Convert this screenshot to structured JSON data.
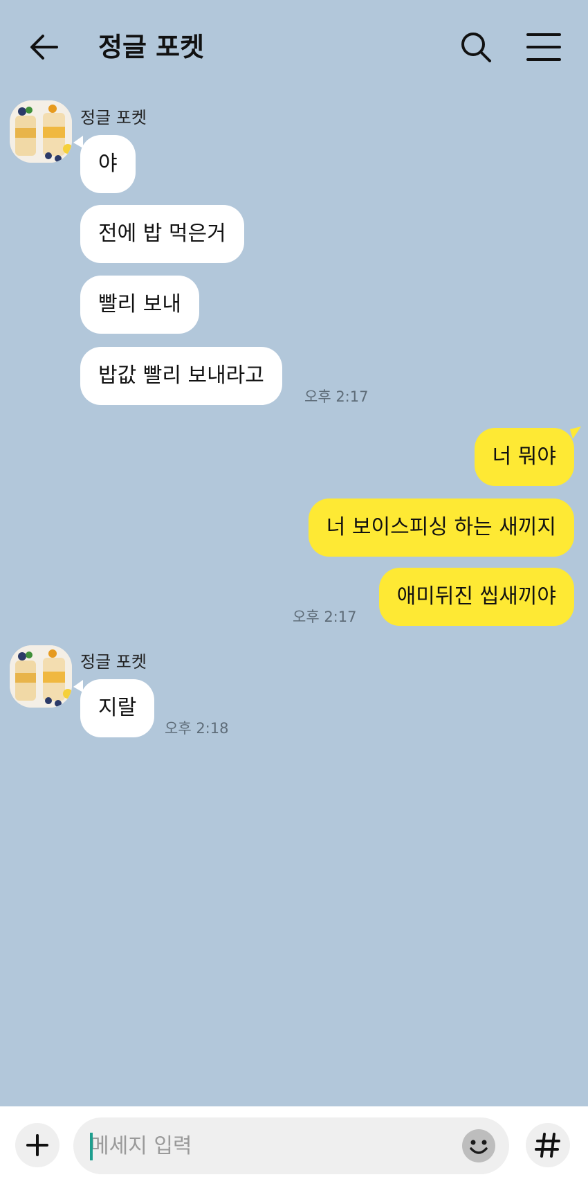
{
  "header": {
    "back_icon": "arrow-left-icon",
    "title": "정글 포켓",
    "search_icon": "search-icon",
    "menu_icon": "hamburger-menu-icon"
  },
  "messages": [
    {
      "direction": "incoming",
      "sender": "정글 포켓",
      "text": "야"
    },
    {
      "direction": "incoming",
      "text": "전에 밥 먹은거"
    },
    {
      "direction": "incoming",
      "text": "빨리 보내"
    },
    {
      "direction": "incoming",
      "text": "밥값 빨리 보내라고",
      "time": "오후 2:17"
    },
    {
      "direction": "outgoing",
      "text": "너 뭐야"
    },
    {
      "direction": "outgoing",
      "text": "너 보이스피싱 하는 새끼지"
    },
    {
      "direction": "outgoing",
      "text": "애미뒤진 씹새끼야",
      "time": "오후 2:17"
    },
    {
      "direction": "incoming",
      "sender": "정글 포켓",
      "text": "지랄",
      "time": "오후 2:18"
    }
  ],
  "input_bar": {
    "plus_icon": "plus-icon",
    "placeholder": "메세지 입력",
    "emoji_icon": "emoji-smile-icon",
    "hash_icon": "hash-icon"
  },
  "colors": {
    "background": "#b2c7da",
    "incoming_bubble": "#ffffff",
    "outgoing_bubble": "#fee934"
  }
}
